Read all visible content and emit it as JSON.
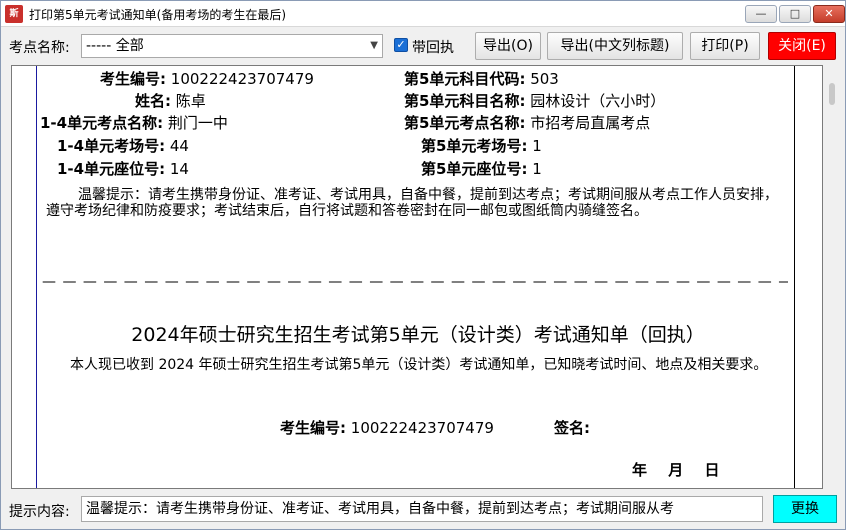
{
  "window": {
    "title": "打印第5单元考试通知单(备用考场的考生在最后)",
    "icon_label": "斯"
  },
  "toolbar": {
    "site_label": "考点名称:",
    "site_value": "----- 全部",
    "receipt_checked": true,
    "receipt_label": "带回执",
    "export_label": "导出(O)",
    "export_cn_label": "导出(中文列标题)",
    "print_label": "打印(P)",
    "close_label": "关闭(E)"
  },
  "notice": {
    "exam_no_label": "考生编号:",
    "exam_no": "100222423707479",
    "name_label": "姓名:",
    "name": "陈卓",
    "u14_site_label": "1-4单元考点名称:",
    "u14_site": "荆门一中",
    "u14_room_label": "1-4单元考场号:",
    "u14_room": "44",
    "u14_seat_label": "1-4单元座位号:",
    "u14_seat": "14",
    "u5_code_label": "第5单元科目代码:",
    "u5_code": "503",
    "u5_subject_label": "第5单元科目名称:",
    "u5_subject": "园林设计（六小时）",
    "u5_site_label": "第5单元考点名称:",
    "u5_site": "市招考局直属考点",
    "u5_room_label": "第5单元考场号:",
    "u5_room": "1",
    "u5_seat_label": "第5单元座位号:",
    "u5_seat": "1",
    "hint": "温馨提示：请考生携带身份证、准考证、考试用具，自备中餐，提前到达考点；考试期间服从考点工作人员安排，遵守考场纪律和防疫要求；考试结束后，自行将试题和答卷密封在同一邮包或图纸筒内骑缝签名。"
  },
  "receipt": {
    "dash_line": "— — — — — — — — — — — — — — — — — — — — — — — — — — — — — — — — — — — — — — — — — —",
    "title": "2024年硕士研究生招生考试第5单元（设计类）考试通知单（回执）",
    "body": "本人现已收到 2024 年硕士研究生招生考试第5单元（设计类）考试通知单，已知晓考试时间、地点及相关要求。",
    "exam_no_label": "考生编号:",
    "exam_no": "100222423707479",
    "sign_label": "签名:",
    "date": "年 月 日"
  },
  "status": {
    "label": "提示内容:",
    "value": "温馨提示：请考生携带身份证、准考证、考试用具，自备中餐，提前到达考点；考试期间服从考",
    "change_label": "更换"
  },
  "colors": {
    "close_button": "#ff0000",
    "change_button": "#00ffff",
    "checkbox": "#1a6fd6"
  }
}
